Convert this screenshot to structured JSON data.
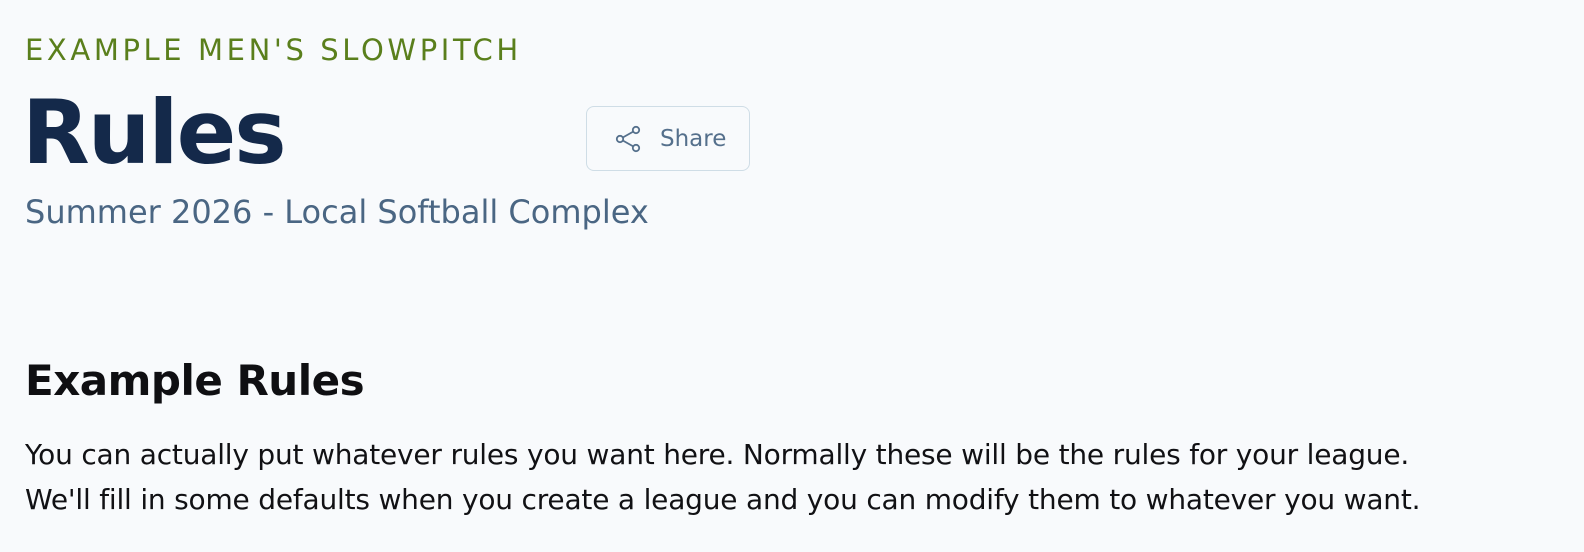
{
  "header": {
    "league_name": "EXAMPLE MEN'S SLOWPITCH",
    "page_title": "Rules",
    "season_location": "Summer 2026 - Local Softball Complex"
  },
  "share_button": {
    "label": "Share",
    "icon": "share-icon"
  },
  "content": {
    "section_heading": "Example Rules",
    "paragraph_lines": [
      "You can actually put whatever rules you want here. Normally these will be the rules for your league.",
      "We'll fill in some defaults when you create a league and you can modify them to whatever you want."
    ]
  },
  "colors": {
    "background": "#f8fafc",
    "eyebrow": "#5a7f1c",
    "title": "#14294a",
    "subtitle": "#4a6683",
    "share_border": "#cfdde6",
    "share_text": "#55708c"
  }
}
